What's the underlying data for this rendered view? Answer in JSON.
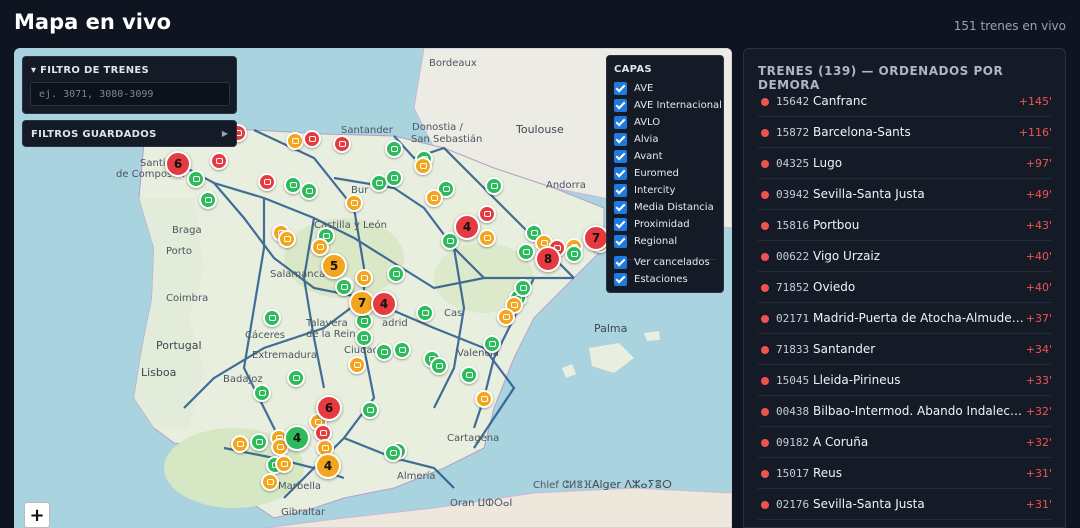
{
  "header": {
    "title": "Mapa en vivo",
    "train_count": "151 trenes en vivo"
  },
  "filter": {
    "title": "FILTRO DE TRENES",
    "placeholder": "ej. 3071, 3080-3099"
  },
  "saved_filters": {
    "title": "FILTROS GUARDADOS"
  },
  "layers": {
    "title": "CAPAS",
    "items": [
      "AVE",
      "AVE Internacional",
      "AVLO",
      "Alvia",
      "Avant",
      "Euromed",
      "Intercity",
      "Media Distancia",
      "Proximidad",
      "Regional"
    ],
    "extras": [
      "Ver cancelados",
      "Estaciones"
    ]
  },
  "map": {
    "zoom_in": "+",
    "labels": {
      "bordeaux": "Bordeaux",
      "santander": "Santander",
      "donostia": "Donostia /",
      "san_sebastian": "San Sebastián",
      "toulouse": "Toulouse",
      "andorra": "Andorra",
      "santiago": "Santia",
      "compostela": "de Compostel",
      "braga": "Braga",
      "porto": "Porto",
      "salamanca": "Salamanca",
      "coimbra": "Coimbra",
      "portugal": "Portugal",
      "talavera": "Talavera",
      "reina": "de la Reina",
      "caceres": "Cáceres",
      "extremadura": "Extremadura",
      "lisboa": "Lisboa",
      "badajoz": "Badajoz",
      "ciudad": "Ciudad",
      "cartagena": "Cartagena",
      "almeria": "Almería",
      "marbella": "Marbella",
      "gibraltar": "Gibraltar",
      "oran": "Oran ⵡⵀⵔⴰⵏ",
      "chlef": "Chlef ⵛⵍⴻⴼ",
      "alger": "Alger ⴷⵣⴰⵢⴻⵔ",
      "palma": "Palma",
      "madrid": "adrid",
      "valencia": "Valencia",
      "bur": "Bur",
      "leon": "Castilla y León",
      "cas": "Cas"
    },
    "clusters": [
      {
        "n": "6",
        "c": "r"
      },
      {
        "n": "4",
        "c": "r"
      },
      {
        "n": "8",
        "c": "r"
      },
      {
        "n": "7",
        "c": "r"
      },
      {
        "n": "5",
        "c": "o"
      },
      {
        "n": "7",
        "c": "o"
      },
      {
        "n": "4",
        "c": "r"
      },
      {
        "n": "6",
        "c": "r"
      },
      {
        "n": "4",
        "c": "g"
      },
      {
        "n": "4",
        "c": "o"
      }
    ],
    "colors": {
      "on_time": "#2dbb5c",
      "delayed": "#f2a51d",
      "late": "#e53a3f"
    }
  },
  "list": {
    "title": "TRENES (139) — ORDENADOS POR DEMORA",
    "rows": [
      {
        "id": "15642",
        "station": "Canfranc",
        "delay": "+145'"
      },
      {
        "id": "15872",
        "station": "Barcelona-Sants",
        "delay": "+116'"
      },
      {
        "id": "04325",
        "station": "Lugo",
        "delay": "+97'"
      },
      {
        "id": "03942",
        "station": "Sevilla-Santa Justa",
        "delay": "+49'"
      },
      {
        "id": "15816",
        "station": "Portbou",
        "delay": "+43'"
      },
      {
        "id": "00622",
        "station": "Vigo Urzaiz",
        "delay": "+40'"
      },
      {
        "id": "71852",
        "station": "Oviedo",
        "delay": "+40'"
      },
      {
        "id": "02171",
        "station": "Madrid-Puerta de Atocha-Almudena Grandes",
        "delay": "+37'"
      },
      {
        "id": "71833",
        "station": "Santander",
        "delay": "+34'"
      },
      {
        "id": "15045",
        "station": "Lleida-Pirineus",
        "delay": "+33'"
      },
      {
        "id": "00438",
        "station": "Bilbao-Intermod. Abando Indalecio Prieto",
        "delay": "+32'"
      },
      {
        "id": "09182",
        "station": "A Coruña",
        "delay": "+32'"
      },
      {
        "id": "15017",
        "station": "Reus",
        "delay": "+31'"
      },
      {
        "id": "02176",
        "station": "Sevilla-Santa Justa",
        "delay": "+31'"
      }
    ]
  }
}
